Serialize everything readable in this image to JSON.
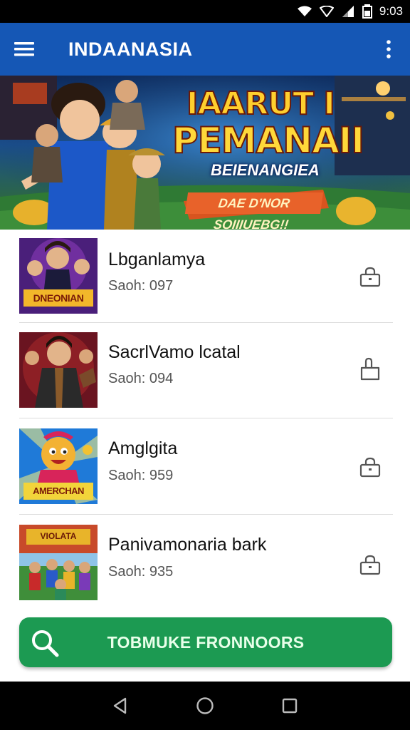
{
  "status_bar": {
    "time": "9:03"
  },
  "app_bar": {
    "title": "INDAANASIA"
  },
  "banner": {
    "title_line1": "IAARUT I",
    "title_line2": "PEMANAII",
    "subtitle": "BEIENANGIEA",
    "tagline": "DAE D'NOR SOIIIUEBG!!"
  },
  "games": [
    {
      "title": "Lbganlamya",
      "subtitle": "Saoh: 097",
      "action_icon": "lock-icon"
    },
    {
      "title": "SacrlVamo lcatal",
      "subtitle": "Saoh: 094",
      "action_icon": "unlock-icon"
    },
    {
      "title": "Amglgita",
      "subtitle": "Saoh: 959",
      "action_icon": "lock-icon"
    },
    {
      "title": "Panivamonaria bark",
      "subtitle": "Saoh: 935",
      "action_icon": "lock-icon"
    }
  ],
  "thumb_labels": [
    "DNEONIAN",
    "AMERCHAN",
    "VIOLATA"
  ],
  "search_button": {
    "label": "TOBMUKE FRONNOORS"
  },
  "colors": {
    "app_bar": "#1557b5",
    "search_button": "#1c9a52",
    "status_bar": "#000000",
    "nav_bar": "#000000"
  }
}
